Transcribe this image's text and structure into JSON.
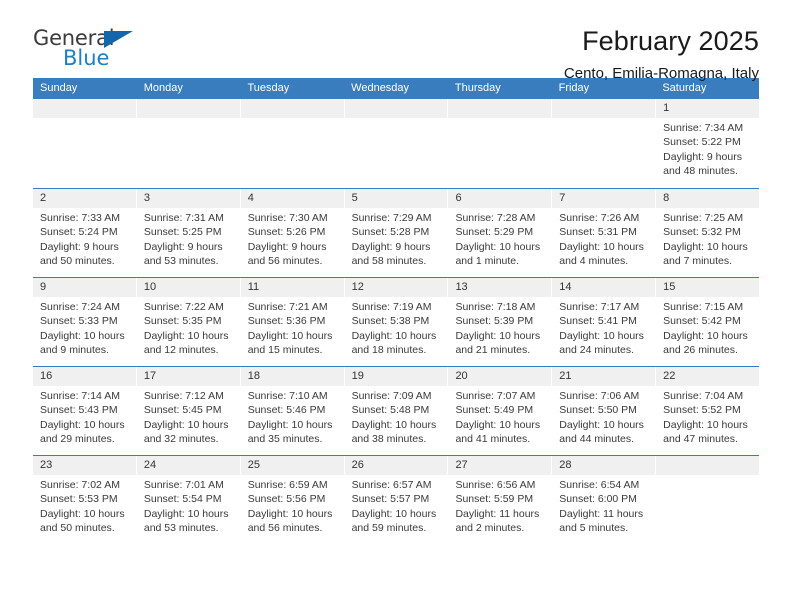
{
  "brand": {
    "name_part1": "General",
    "name_part2": "Blue",
    "triangle_icon": "logo-triangle-icon",
    "accent_color": "#1f7ec4"
  },
  "header": {
    "title": "February 2025",
    "subtitle": "Cento, Emilia-Romagna, Italy"
  },
  "calendar": {
    "header_color": "#3a7dbf",
    "day_strip_color": "#f0f0f0",
    "weekdays": [
      "Sunday",
      "Monday",
      "Tuesday",
      "Wednesday",
      "Thursday",
      "Friday",
      "Saturday"
    ],
    "weeks": [
      [
        {
          "day": "",
          "sunrise": "",
          "sunset": "",
          "daylight1": "",
          "daylight2": ""
        },
        {
          "day": "",
          "sunrise": "",
          "sunset": "",
          "daylight1": "",
          "daylight2": ""
        },
        {
          "day": "",
          "sunrise": "",
          "sunset": "",
          "daylight1": "",
          "daylight2": ""
        },
        {
          "day": "",
          "sunrise": "",
          "sunset": "",
          "daylight1": "",
          "daylight2": ""
        },
        {
          "day": "",
          "sunrise": "",
          "sunset": "",
          "daylight1": "",
          "daylight2": ""
        },
        {
          "day": "",
          "sunrise": "",
          "sunset": "",
          "daylight1": "",
          "daylight2": ""
        },
        {
          "day": "1",
          "sunrise": "Sunrise: 7:34 AM",
          "sunset": "Sunset: 5:22 PM",
          "daylight1": "Daylight: 9 hours",
          "daylight2": "and 48 minutes."
        }
      ],
      [
        {
          "day": "2",
          "sunrise": "Sunrise: 7:33 AM",
          "sunset": "Sunset: 5:24 PM",
          "daylight1": "Daylight: 9 hours",
          "daylight2": "and 50 minutes."
        },
        {
          "day": "3",
          "sunrise": "Sunrise: 7:31 AM",
          "sunset": "Sunset: 5:25 PM",
          "daylight1": "Daylight: 9 hours",
          "daylight2": "and 53 minutes."
        },
        {
          "day": "4",
          "sunrise": "Sunrise: 7:30 AM",
          "sunset": "Sunset: 5:26 PM",
          "daylight1": "Daylight: 9 hours",
          "daylight2": "and 56 minutes."
        },
        {
          "day": "5",
          "sunrise": "Sunrise: 7:29 AM",
          "sunset": "Sunset: 5:28 PM",
          "daylight1": "Daylight: 9 hours",
          "daylight2": "and 58 minutes."
        },
        {
          "day": "6",
          "sunrise": "Sunrise: 7:28 AM",
          "sunset": "Sunset: 5:29 PM",
          "daylight1": "Daylight: 10 hours",
          "daylight2": "and 1 minute."
        },
        {
          "day": "7",
          "sunrise": "Sunrise: 7:26 AM",
          "sunset": "Sunset: 5:31 PM",
          "daylight1": "Daylight: 10 hours",
          "daylight2": "and 4 minutes."
        },
        {
          "day": "8",
          "sunrise": "Sunrise: 7:25 AM",
          "sunset": "Sunset: 5:32 PM",
          "daylight1": "Daylight: 10 hours",
          "daylight2": "and 7 minutes."
        }
      ],
      [
        {
          "day": "9",
          "sunrise": "Sunrise: 7:24 AM",
          "sunset": "Sunset: 5:33 PM",
          "daylight1": "Daylight: 10 hours",
          "daylight2": "and 9 minutes."
        },
        {
          "day": "10",
          "sunrise": "Sunrise: 7:22 AM",
          "sunset": "Sunset: 5:35 PM",
          "daylight1": "Daylight: 10 hours",
          "daylight2": "and 12 minutes."
        },
        {
          "day": "11",
          "sunrise": "Sunrise: 7:21 AM",
          "sunset": "Sunset: 5:36 PM",
          "daylight1": "Daylight: 10 hours",
          "daylight2": "and 15 minutes."
        },
        {
          "day": "12",
          "sunrise": "Sunrise: 7:19 AM",
          "sunset": "Sunset: 5:38 PM",
          "daylight1": "Daylight: 10 hours",
          "daylight2": "and 18 minutes."
        },
        {
          "day": "13",
          "sunrise": "Sunrise: 7:18 AM",
          "sunset": "Sunset: 5:39 PM",
          "daylight1": "Daylight: 10 hours",
          "daylight2": "and 21 minutes."
        },
        {
          "day": "14",
          "sunrise": "Sunrise: 7:17 AM",
          "sunset": "Sunset: 5:41 PM",
          "daylight1": "Daylight: 10 hours",
          "daylight2": "and 24 minutes."
        },
        {
          "day": "15",
          "sunrise": "Sunrise: 7:15 AM",
          "sunset": "Sunset: 5:42 PM",
          "daylight1": "Daylight: 10 hours",
          "daylight2": "and 26 minutes."
        }
      ],
      [
        {
          "day": "16",
          "sunrise": "Sunrise: 7:14 AM",
          "sunset": "Sunset: 5:43 PM",
          "daylight1": "Daylight: 10 hours",
          "daylight2": "and 29 minutes."
        },
        {
          "day": "17",
          "sunrise": "Sunrise: 7:12 AM",
          "sunset": "Sunset: 5:45 PM",
          "daylight1": "Daylight: 10 hours",
          "daylight2": "and 32 minutes."
        },
        {
          "day": "18",
          "sunrise": "Sunrise: 7:10 AM",
          "sunset": "Sunset: 5:46 PM",
          "daylight1": "Daylight: 10 hours",
          "daylight2": "and 35 minutes."
        },
        {
          "day": "19",
          "sunrise": "Sunrise: 7:09 AM",
          "sunset": "Sunset: 5:48 PM",
          "daylight1": "Daylight: 10 hours",
          "daylight2": "and 38 minutes."
        },
        {
          "day": "20",
          "sunrise": "Sunrise: 7:07 AM",
          "sunset": "Sunset: 5:49 PM",
          "daylight1": "Daylight: 10 hours",
          "daylight2": "and 41 minutes."
        },
        {
          "day": "21",
          "sunrise": "Sunrise: 7:06 AM",
          "sunset": "Sunset: 5:50 PM",
          "daylight1": "Daylight: 10 hours",
          "daylight2": "and 44 minutes."
        },
        {
          "day": "22",
          "sunrise": "Sunrise: 7:04 AM",
          "sunset": "Sunset: 5:52 PM",
          "daylight1": "Daylight: 10 hours",
          "daylight2": "and 47 minutes."
        }
      ],
      [
        {
          "day": "23",
          "sunrise": "Sunrise: 7:02 AM",
          "sunset": "Sunset: 5:53 PM",
          "daylight1": "Daylight: 10 hours",
          "daylight2": "and 50 minutes."
        },
        {
          "day": "24",
          "sunrise": "Sunrise: 7:01 AM",
          "sunset": "Sunset: 5:54 PM",
          "daylight1": "Daylight: 10 hours",
          "daylight2": "and 53 minutes."
        },
        {
          "day": "25",
          "sunrise": "Sunrise: 6:59 AM",
          "sunset": "Sunset: 5:56 PM",
          "daylight1": "Daylight: 10 hours",
          "daylight2": "and 56 minutes."
        },
        {
          "day": "26",
          "sunrise": "Sunrise: 6:57 AM",
          "sunset": "Sunset: 5:57 PM",
          "daylight1": "Daylight: 10 hours",
          "daylight2": "and 59 minutes."
        },
        {
          "day": "27",
          "sunrise": "Sunrise: 6:56 AM",
          "sunset": "Sunset: 5:59 PM",
          "daylight1": "Daylight: 11 hours",
          "daylight2": "and 2 minutes."
        },
        {
          "day": "28",
          "sunrise": "Sunrise: 6:54 AM",
          "sunset": "Sunset: 6:00 PM",
          "daylight1": "Daylight: 11 hours",
          "daylight2": "and 5 minutes."
        },
        {
          "day": "",
          "sunrise": "",
          "sunset": "",
          "daylight1": "",
          "daylight2": ""
        }
      ]
    ]
  }
}
